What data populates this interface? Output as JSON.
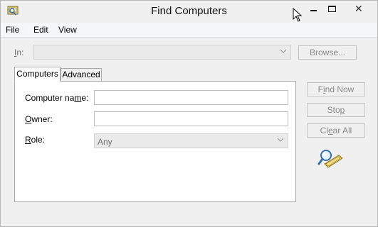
{
  "window": {
    "title": "Find Computers",
    "icon": "find-computers-app-icon",
    "controls": {
      "minimize": "minimize-icon",
      "maximize": "maximize-icon",
      "close": "close-icon"
    }
  },
  "menu": {
    "items": [
      "File",
      "Edit",
      "View"
    ]
  },
  "in_row": {
    "label_first": "I",
    "label_rest": "n:",
    "value": "",
    "browse_label": "Browse..."
  },
  "tabs": [
    {
      "label": "Computers",
      "active": true
    },
    {
      "label": "Advanced",
      "active": false
    }
  ],
  "fields": {
    "computer_name": {
      "label_pre": "Computer na",
      "label_u": "m",
      "label_post": "e:",
      "value": ""
    },
    "owner": {
      "label_first": "O",
      "label_rest": "wner:",
      "value": ""
    },
    "role": {
      "label_first": "R",
      "label_rest": "ole:",
      "value": "Any"
    }
  },
  "actions": {
    "find_now": {
      "pre": "F",
      "u": "i",
      "post": "nd Now"
    },
    "stop": {
      "pre": "Sto",
      "u": "p",
      "post": ""
    },
    "clear_all": {
      "pre": "Cl",
      "u": "e",
      "post": "ar All"
    }
  },
  "graphic": "magnifier-over-computer-icon"
}
